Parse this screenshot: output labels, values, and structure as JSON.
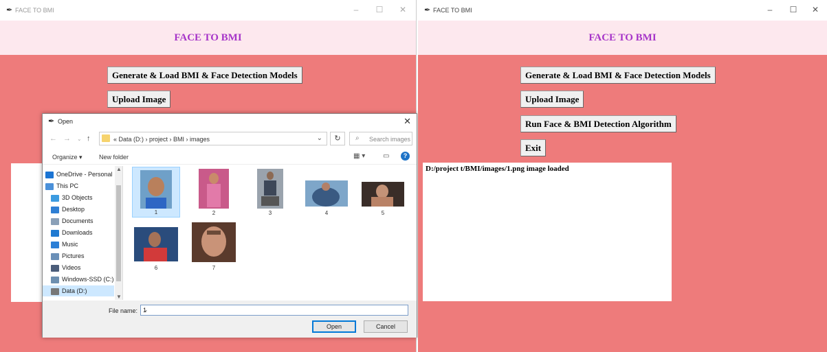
{
  "left_window": {
    "title": "FACE TO BMI",
    "header": "FACE TO BMI",
    "buttons": {
      "generate": "Generate & Load BMI & Face Detection Models",
      "upload": "Upload Image"
    }
  },
  "open_dialog": {
    "title": "Open",
    "address_path": "«  Data (D:)  ›  project  ›  BMI  ›  images",
    "search_placeholder": "Search images",
    "toolbar": {
      "organize": "Organize ▾",
      "new_folder": "New folder"
    },
    "nav_items": [
      {
        "label": "OneDrive - Personal",
        "color": "#1b74d3"
      },
      {
        "label": "This PC",
        "color": "#4a90d9"
      },
      {
        "label": "3D Objects",
        "color": "#3c9be0"
      },
      {
        "label": "Desktop",
        "color": "#2f7fd4"
      },
      {
        "label": "Documents",
        "color": "#8aa0b8"
      },
      {
        "label": "Downloads",
        "color": "#1f7ad1"
      },
      {
        "label": "Music",
        "color": "#2b7fd6"
      },
      {
        "label": "Pictures",
        "color": "#6b90b8"
      },
      {
        "label": "Videos",
        "color": "#4b5d7a"
      },
      {
        "label": "Windows-SSD (C:)",
        "color": "#6d8fb0"
      },
      {
        "label": "Data (D:)",
        "color": "#777777"
      }
    ],
    "files": [
      "1",
      "2",
      "3",
      "4",
      "5",
      "6",
      "7"
    ],
    "filename_label": "File name:",
    "filename_value": "1",
    "open_button": "Open",
    "cancel_button": "Cancel"
  },
  "right_window": {
    "title": "FACE TO BMI",
    "header": "FACE TO BMI",
    "buttons": {
      "generate": "Generate & Load BMI & Face Detection Models",
      "upload": "Upload Image",
      "run": "Run Face & BMI Detection Algorithm",
      "exit": "Exit"
    },
    "status_text": "D:/project t/BMI/images/1.png image loaded"
  },
  "colors": {
    "app_background": "#ee7b7b",
    "header_background": "#fde8ee",
    "header_text": "#a634c8"
  }
}
